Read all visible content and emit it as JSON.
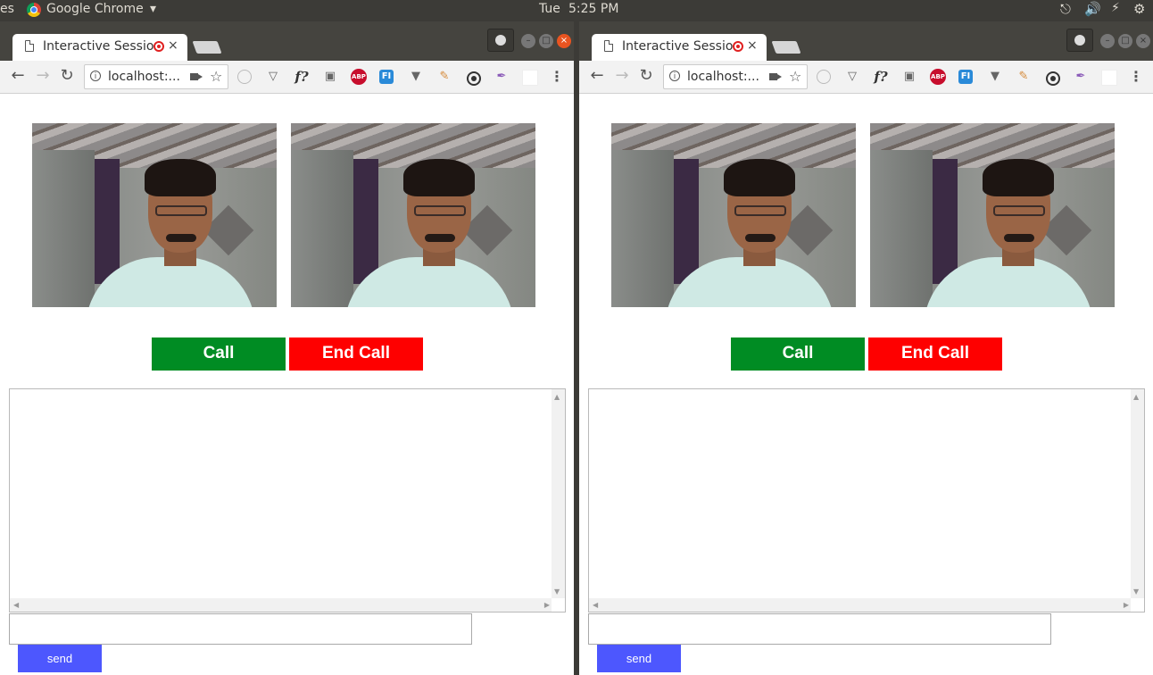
{
  "topbar": {
    "app_fragment": "es",
    "app_name": "Google Chrome",
    "app_menu_arrow": "▾",
    "day": "Tue",
    "time": "5:25 PM",
    "icons": [
      "network-icon",
      "volume-icon",
      "battery-icon",
      "power-icon"
    ]
  },
  "windows": [
    {
      "tab": {
        "title": "Interactive Session",
        "close": "×"
      },
      "omnibox": {
        "url": "localhost:...",
        "info": "i"
      },
      "nav": {
        "back": "←",
        "forward": "→",
        "reload": "↻"
      },
      "bookmark_star": "☆",
      "extensions": {
        "fquestion": "f?",
        "abp": "ABP",
        "fi": "FI",
        "menu": "⋮"
      },
      "buttons": {
        "call": "Call",
        "end_call": "End Call",
        "send": "send"
      },
      "chat": {
        "log": "",
        "message_input": ""
      }
    },
    {
      "tab": {
        "title": "Interactive Session",
        "close": "×"
      },
      "omnibox": {
        "url": "localhost:...",
        "info": "i"
      },
      "nav": {
        "back": "←",
        "forward": "→",
        "reload": "↻"
      },
      "bookmark_star": "☆",
      "extensions": {
        "fquestion": "f?",
        "abp": "ABP",
        "fi": "FI",
        "menu": "⋮"
      },
      "buttons": {
        "call": "Call",
        "end_call": "End Call",
        "send": "send"
      },
      "chat": {
        "log": "",
        "message_input": ""
      }
    }
  ],
  "colors": {
    "call_button": "#008c23",
    "end_call_button": "#fe0000",
    "send_button": "#4d57fe",
    "ubuntu_bar": "#3c3b37",
    "window_close": "#e95420"
  }
}
